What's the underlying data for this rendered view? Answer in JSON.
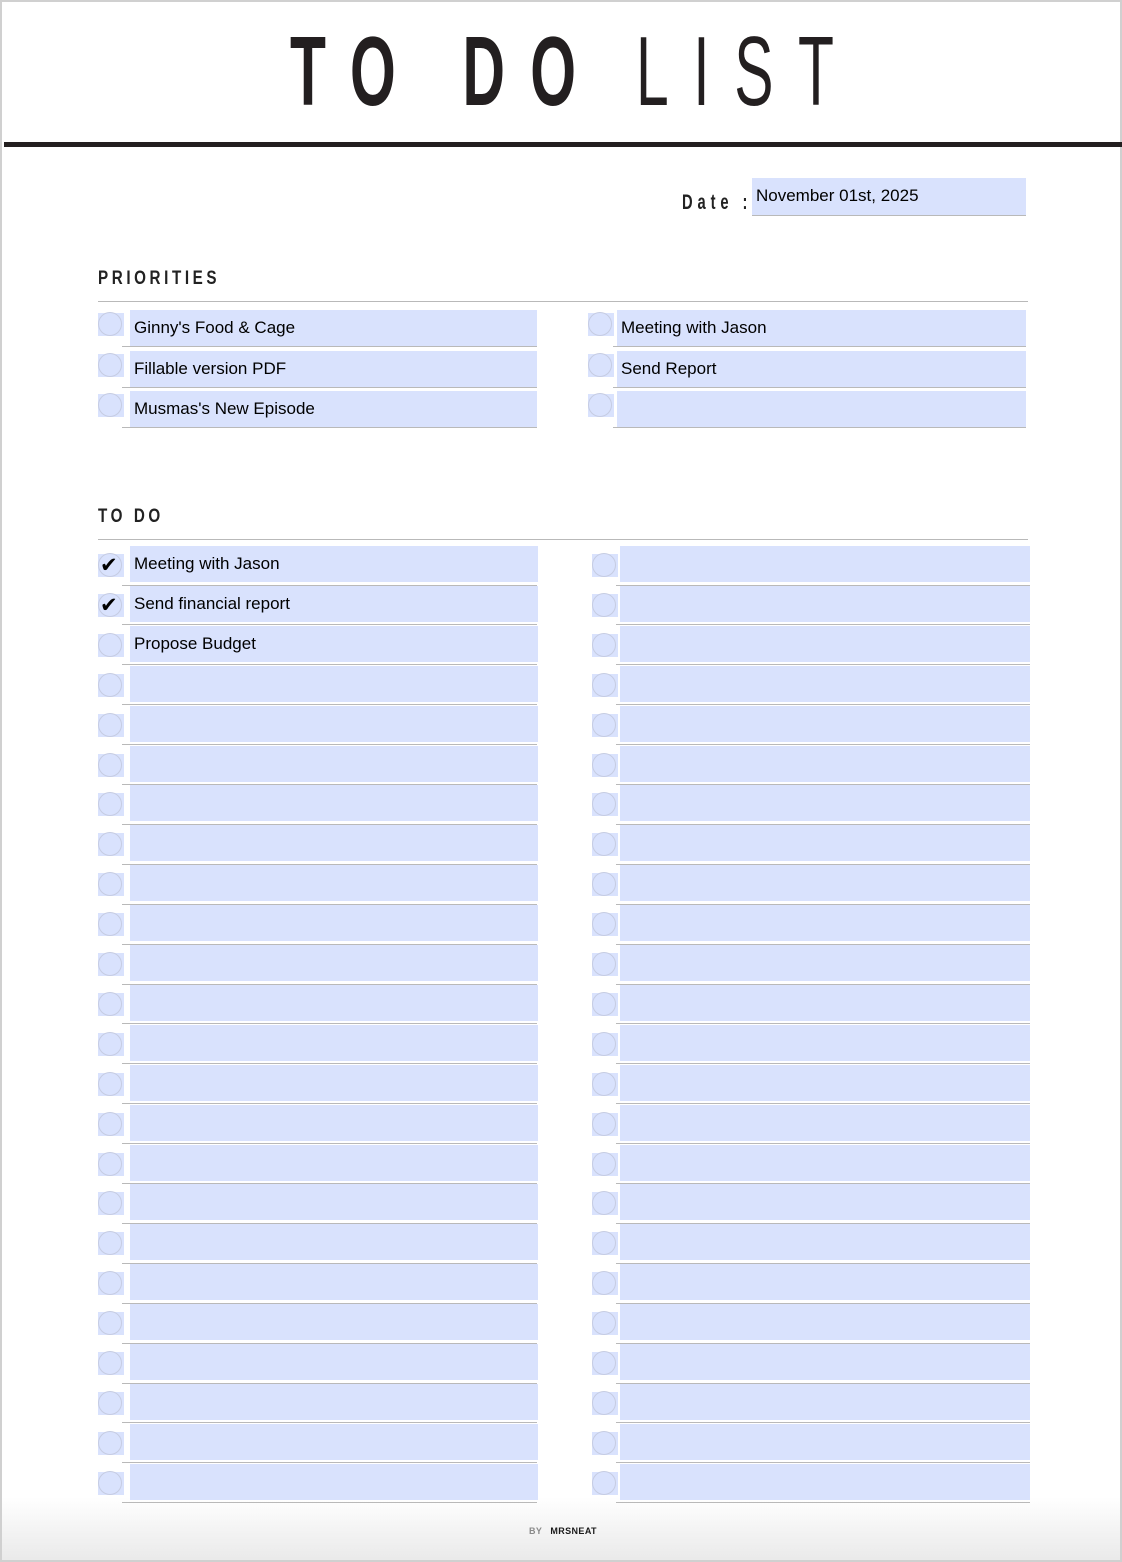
{
  "header": {
    "title_bold": "TO DO",
    "title_light": "LIST"
  },
  "date": {
    "label": "Date :",
    "value": "November 01st, 2025"
  },
  "priorities": {
    "heading": "PRIORITIES",
    "left_column": [
      {
        "text": "Ginny's Food & Cage",
        "checked": false
      },
      {
        "text": "Fillable version PDF",
        "checked": false
      },
      {
        "text": "Musmas's New Episode",
        "checked": false
      }
    ],
    "right_column": [
      {
        "text": "Meeting with Jason",
        "checked": false
      },
      {
        "text": "Send Report",
        "checked": false
      },
      {
        "text": "",
        "checked": false
      }
    ]
  },
  "todo": {
    "heading": "TO DO",
    "left_column": [
      {
        "text": "Meeting with Jason",
        "checked": true
      },
      {
        "text": "Send financial report",
        "checked": true
      },
      {
        "text": "Propose Budget",
        "checked": false
      },
      {
        "text": "",
        "checked": false
      },
      {
        "text": "",
        "checked": false
      },
      {
        "text": "",
        "checked": false
      },
      {
        "text": "",
        "checked": false
      },
      {
        "text": "",
        "checked": false
      },
      {
        "text": "",
        "checked": false
      },
      {
        "text": "",
        "checked": false
      },
      {
        "text": "",
        "checked": false
      },
      {
        "text": "",
        "checked": false
      },
      {
        "text": "",
        "checked": false
      },
      {
        "text": "",
        "checked": false
      },
      {
        "text": "",
        "checked": false
      },
      {
        "text": "",
        "checked": false
      },
      {
        "text": "",
        "checked": false
      },
      {
        "text": "",
        "checked": false
      },
      {
        "text": "",
        "checked": false
      },
      {
        "text": "",
        "checked": false
      },
      {
        "text": "",
        "checked": false
      },
      {
        "text": "",
        "checked": false
      },
      {
        "text": "",
        "checked": false
      },
      {
        "text": "",
        "checked": false
      }
    ],
    "right_column": [
      {
        "text": "",
        "checked": false
      },
      {
        "text": "",
        "checked": false
      },
      {
        "text": "",
        "checked": false
      },
      {
        "text": "",
        "checked": false
      },
      {
        "text": "",
        "checked": false
      },
      {
        "text": "",
        "checked": false
      },
      {
        "text": "",
        "checked": false
      },
      {
        "text": "",
        "checked": false
      },
      {
        "text": "",
        "checked": false
      },
      {
        "text": "",
        "checked": false
      },
      {
        "text": "",
        "checked": false
      },
      {
        "text": "",
        "checked": false
      },
      {
        "text": "",
        "checked": false
      },
      {
        "text": "",
        "checked": false
      },
      {
        "text": "",
        "checked": false
      },
      {
        "text": "",
        "checked": false
      },
      {
        "text": "",
        "checked": false
      },
      {
        "text": "",
        "checked": false
      },
      {
        "text": "",
        "checked": false
      },
      {
        "text": "",
        "checked": false
      },
      {
        "text": "",
        "checked": false
      },
      {
        "text": "",
        "checked": false
      },
      {
        "text": "",
        "checked": false
      },
      {
        "text": "",
        "checked": false
      }
    ]
  },
  "footer": {
    "by": "BY",
    "brand": "MRSNEAT"
  },
  "colors": {
    "field_fill": "#d9e2fd",
    "rule": "#b9b9b9",
    "ink": "#231f20",
    "checkbox_circle": "#c6cce2"
  }
}
